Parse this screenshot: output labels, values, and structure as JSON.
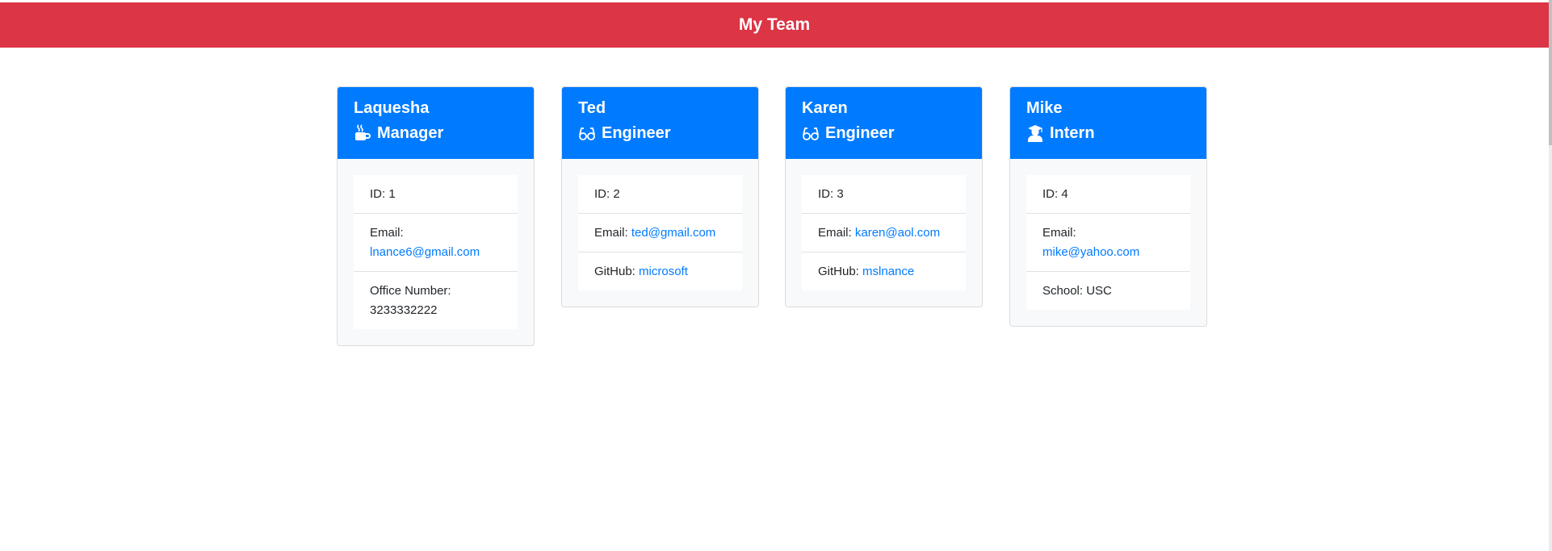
{
  "header": {
    "title": "My Team"
  },
  "colors": {
    "header_bg": "#dc3545",
    "card_header_bg": "#007bff",
    "link": "#007bff"
  },
  "cards": [
    {
      "name": "Laquesha",
      "role": "Manager",
      "icon": "mug-icon",
      "id_label": "ID: 1",
      "email_label": "Email:",
      "email": "lnance6@gmail.com",
      "extra_label": "Office Number:",
      "extra_value": "3233332222"
    },
    {
      "name": "Ted",
      "role": "Engineer",
      "icon": "glasses-icon",
      "id_label": "ID: 2",
      "email_label": "Email:",
      "email": "ted@gmail.com",
      "extra_label": "GitHub:",
      "extra_value": "microsoft"
    },
    {
      "name": "Karen",
      "role": "Engineer",
      "icon": "glasses-icon",
      "id_label": "ID: 3",
      "email_label": "Email:",
      "email": "karen@aol.com",
      "extra_label": "GitHub:",
      "extra_value": "mslnance"
    },
    {
      "name": "Mike",
      "role": "Intern",
      "icon": "graduate-icon",
      "id_label": "ID: 4",
      "email_label": "Email:",
      "email": "mike@yahoo.com",
      "extra_label": "School:",
      "extra_value": "USC"
    }
  ]
}
